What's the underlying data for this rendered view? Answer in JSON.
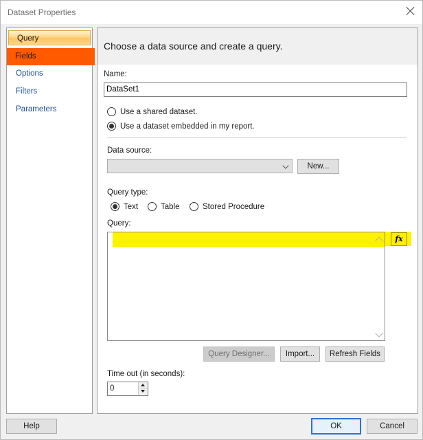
{
  "window": {
    "title": "Dataset Properties"
  },
  "nav": {
    "items": [
      {
        "label": "Query"
      },
      {
        "label": "Fields"
      },
      {
        "label": "Options"
      },
      {
        "label": "Filters"
      },
      {
        "label": "Parameters"
      }
    ]
  },
  "main": {
    "header": "Choose a data source and create a query.",
    "name_label": "Name:",
    "name_value": "DataSet1",
    "radio_shared": "Use a shared dataset.",
    "radio_embedded": "Use a dataset embedded in my report.",
    "data_source_label": "Data source:",
    "data_source_value": "",
    "new_button": "New...",
    "query_type_label": "Query type:",
    "query_type_text": "Text",
    "query_type_table": "Table",
    "query_type_sp": "Stored Procedure",
    "query_label": "Query:",
    "query_value": "",
    "fx_label": "fx",
    "query_designer_button": "Query Designer...",
    "import_button": "Import...",
    "refresh_fields_button": "Refresh Fields",
    "timeout_label": "Time out (in seconds):",
    "timeout_value": "0"
  },
  "footer": {
    "help": "Help",
    "ok": "OK",
    "cancel": "Cancel"
  },
  "colors": {
    "highlight": "#fff200",
    "selected_nav": "#ffc45f",
    "fields_nav": "#ff5a00",
    "link_blue": "#1f4f91",
    "ok_border": "#2a72d2"
  }
}
